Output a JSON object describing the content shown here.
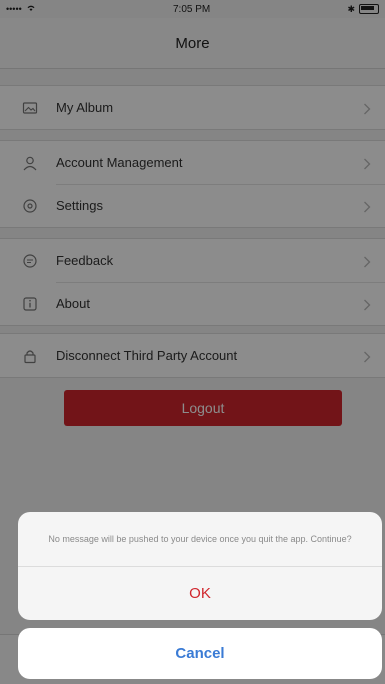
{
  "status_bar": {
    "signal": "•••••",
    "time": "7:05 PM"
  },
  "header": {
    "title": "More"
  },
  "menu": {
    "group1": [
      {
        "label": "My Album",
        "icon": "album-icon"
      }
    ],
    "group2": [
      {
        "label": "Account Management",
        "icon": "person-icon"
      },
      {
        "label": "Settings",
        "icon": "gear-icon"
      }
    ],
    "group3": [
      {
        "label": "Feedback",
        "icon": "feedback-icon"
      },
      {
        "label": "About",
        "icon": "info-icon"
      }
    ],
    "group4": [
      {
        "label": "Disconnect Third Party Account",
        "icon": "lock-icon"
      }
    ]
  },
  "logout": {
    "label": "Logout"
  },
  "action_sheet": {
    "message": "No message will be pushed to your device once you quit the app. Continue?",
    "ok_label": "OK",
    "cancel_label": "Cancel"
  },
  "colors": {
    "accent_red": "#d0262d",
    "cancel_blue": "#3a7bd5"
  }
}
